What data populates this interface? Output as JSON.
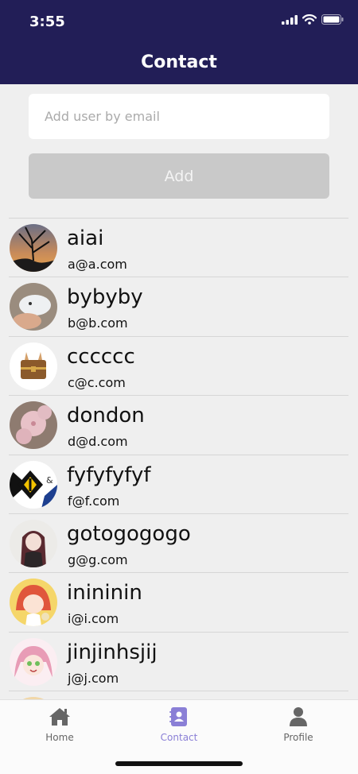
{
  "status_bar": {
    "time": "3:55"
  },
  "header": {
    "title": "Contact"
  },
  "add_form": {
    "email_placeholder": "Add user by email",
    "add_label": "Add"
  },
  "contacts": [
    {
      "name": "aiai",
      "email": "a@a.com"
    },
    {
      "name": "bybyby",
      "email": "b@b.com"
    },
    {
      "name": "cccccc",
      "email": "c@c.com"
    },
    {
      "name": "dondon",
      "email": "d@d.com"
    },
    {
      "name": "fyfyfyfyf",
      "email": "f@f.com"
    },
    {
      "name": "gotogogogo",
      "email": "g@g.com"
    },
    {
      "name": "inininin",
      "email": "i@i.com"
    },
    {
      "name": "jinjinhsjij",
      "email": "j@j.com"
    }
  ],
  "tabbar": {
    "home": "Home",
    "contact": "Contact",
    "profile": "Profile",
    "active_tab": "contact"
  },
  "colors": {
    "header_bg": "#221e57",
    "active_tab": "#8a7fd6",
    "disabled_button": "#c9c9c9"
  }
}
